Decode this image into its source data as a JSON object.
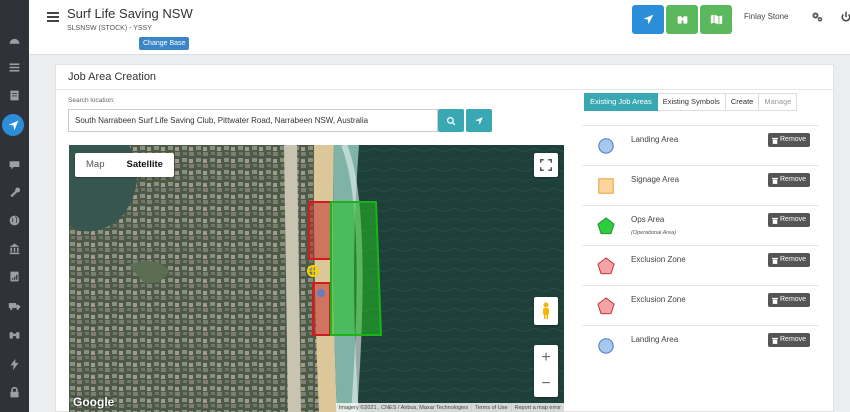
{
  "header": {
    "title": "Surf Life Saving NSW",
    "subtitle": "SLSNSW (STOCK) - YSSY",
    "change_base_label": "Change Base",
    "user_name": "Finlay Stone"
  },
  "colors": {
    "primary_blue": "#2a8fd8",
    "success_green": "#5cb85c",
    "teal": "#3aa8b2",
    "sidebar": "#2f3238"
  },
  "sidebar": {
    "icons": [
      "dashboard-icon",
      "list-icon",
      "document-icon",
      "navigation-icon",
      "chat-icon",
      "wrench-icon",
      "globe-icon",
      "bank-icon",
      "report-icon",
      "truck-icon",
      "binoculars-icon",
      "bolt-icon",
      "lock-icon"
    ],
    "active": "navigation-icon"
  },
  "toolbar": {
    "buttons": [
      "plane-icon",
      "binoculars-icon",
      "map-icon"
    ]
  },
  "page": {
    "title": "Job Area Creation",
    "search_label": "Search location:",
    "search_value": "South Narrabeen Surf Life Saving Club, Pittwater Road, Narrabeen NSW, Australia"
  },
  "map": {
    "type_map_label": "Map",
    "type_satellite_label": "Satellite",
    "selected_type": "Satellite",
    "google_label": "Google",
    "footer": [
      "Imagery ©2021 , CNES / Airbus, Maxar Technologies",
      "Terms of Use",
      "Report a map error"
    ],
    "zoom_in": "+",
    "zoom_out": "−"
  },
  "tabs": [
    {
      "label": "Existing Job Areas",
      "state": "active"
    },
    {
      "label": "Existing Symbols",
      "state": "normal"
    },
    {
      "label": "Create",
      "state": "normal"
    },
    {
      "label": "Manage",
      "state": "disabled"
    }
  ],
  "job_areas": [
    {
      "name": "Landing Area",
      "note": "",
      "shape": "circle",
      "color": "#a7c7ec",
      "stroke": "#3a6fc4",
      "remove_label": "Remove"
    },
    {
      "name": "Signage Area",
      "note": "",
      "shape": "square",
      "color": "#fbd49e",
      "stroke": "#e0962a",
      "remove_label": "Remove"
    },
    {
      "name": "Ops Area",
      "note": "(Operational Area)",
      "shape": "pentagon",
      "color": "#2ecc40",
      "stroke": "#1e8a2a",
      "remove_label": "Remove"
    },
    {
      "name": "Exclusion Zone",
      "note": "",
      "shape": "pentagon",
      "color": "#f4a3a6",
      "stroke": "#c0262c",
      "remove_label": "Remove"
    },
    {
      "name": "Exclusion Zone",
      "note": "",
      "shape": "pentagon",
      "color": "#f4a3a6",
      "stroke": "#c0262c",
      "remove_label": "Remove"
    },
    {
      "name": "Landing Area",
      "note": "",
      "shape": "circle",
      "color": "#a7c7ec",
      "stroke": "#3a6fc4",
      "remove_label": "Remove"
    }
  ]
}
